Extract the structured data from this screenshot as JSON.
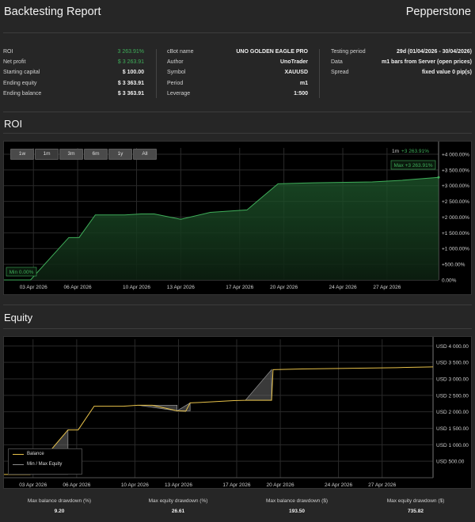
{
  "header": {
    "title": "Backtesting Report",
    "brand": "Pepperstone"
  },
  "summary": {
    "col1": [
      {
        "label": "ROI",
        "value": "3 263.91%",
        "color": "green"
      },
      {
        "label": "Net profit",
        "value": "$ 3 263.91",
        "color": "green"
      },
      {
        "label": "Starting capital",
        "value": "$ 100.00"
      },
      {
        "label": "Ending equity",
        "value": "$ 3 363.91"
      },
      {
        "label": "Ending balance",
        "value": "$ 3 363.91"
      }
    ],
    "col2": [
      {
        "label": "cBot name",
        "value": "UNO GOLDEN EAGLE PRO"
      },
      {
        "label": "Author",
        "value": "UnoTrader"
      },
      {
        "label": "Symbol",
        "value": "XAUUSD"
      },
      {
        "label": "Period",
        "value": "m1"
      },
      {
        "label": "Leverage",
        "value": "1:500"
      }
    ],
    "col3": [
      {
        "label": "Testing period",
        "value": "29d (01/04/2026 - 30/04/2026)"
      },
      {
        "label": "Data",
        "value": "m1 bars from Server (open prices)"
      },
      {
        "label": "Spread",
        "value": "fixed value 0 pip(s)"
      }
    ]
  },
  "roi_section": {
    "title": "ROI",
    "range_buttons": [
      "1w",
      "1m",
      "3m",
      "6m",
      "1y",
      "All"
    ],
    "active_range": "1m",
    "period_label": "1m",
    "current_label": "+3 263.91%",
    "max_label": "Max +3 263.91%",
    "min_label": "Min 0.00%"
  },
  "equity_section": {
    "title": "Equity",
    "legend": [
      "Balance",
      "Min / Max Equity"
    ]
  },
  "colors": {
    "roi_line": "#3fae5a",
    "balance_line": "#e8c24a",
    "equity_band": "#6a6a6a",
    "green_text": "#3fae5a"
  },
  "chart_data": [
    {
      "type": "area",
      "title": "ROI",
      "x_ticks": [
        "03 Apr 2026",
        "06 Apr 2026",
        "10 Apr 2026",
        "13 Apr 2026",
        "17 Apr 2026",
        "20 Apr 2026",
        "24 Apr 2026",
        "27 Apr 2026"
      ],
      "y_ticks": [
        "+4 000.00%",
        "+3 500.00%",
        "+3 000.00%",
        "+2 500.00%",
        "+2 000.00%",
        "+1 500.00%",
        "+1 000.00%",
        "+500.00%",
        "0.00%"
      ],
      "ylim": [
        0,
        4200
      ],
      "day_range": [
        1,
        30.5
      ],
      "series": [
        {
          "name": "ROI",
          "points": [
            [
              1,
              0
            ],
            [
              2.8,
              0
            ],
            [
              5.4,
              1350
            ],
            [
              6.1,
              1350
            ],
            [
              7.2,
              2070
            ],
            [
              9.2,
              2070
            ],
            [
              10.3,
              2100
            ],
            [
              11.2,
              2100
            ],
            [
              13.0,
              1930
            ],
            [
              15.0,
              2150
            ],
            [
              17.5,
              2230
            ],
            [
              19.6,
              3060
            ],
            [
              22.0,
              3090
            ],
            [
              26.0,
              3120
            ],
            [
              28.0,
              3170
            ],
            [
              30.5,
              3263.91
            ]
          ]
        }
      ]
    },
    {
      "type": "line",
      "title": "Equity",
      "x_ticks": [
        "03 Apr 2026",
        "06 Apr 2026",
        "10 Apr 2026",
        "13 Apr 2026",
        "17 Apr 2026",
        "20 Apr 2026",
        "24 Apr 2026",
        "27 Apr 2026"
      ],
      "y_ticks": [
        "USD 4 000.00",
        "USD 3 500.00",
        "USD 3 000.00",
        "USD 2 500.00",
        "USD 2 000.00",
        "USD 1 500.00",
        "USD 1 000.00",
        "USD 500.00"
      ],
      "ylim": [
        0,
        4200
      ],
      "day_range": [
        1,
        30.5
      ],
      "series": [
        {
          "name": "Balance",
          "points": [
            [
              1,
              100
            ],
            [
              2.8,
              100
            ],
            [
              5.4,
              1450
            ],
            [
              6.1,
              1450
            ],
            [
              7.2,
              2170
            ],
            [
              9.2,
              2170
            ],
            [
              10.2,
              2200
            ],
            [
              11.2,
              2200
            ],
            [
              12.9,
              2030
            ],
            [
              13.5,
              2020
            ],
            [
              13.8,
              2270
            ],
            [
              15.2,
              2300
            ],
            [
              16.8,
              2340
            ],
            [
              17.6,
              2350
            ],
            [
              19.4,
              2350
            ],
            [
              19.5,
              3280
            ],
            [
              21.5,
              3300
            ],
            [
              25.0,
              3320
            ],
            [
              28.0,
              3340
            ],
            [
              30.5,
              3363.91
            ]
          ]
        },
        {
          "name": "Min / Max Equity",
          "bands": [
            [
              [
                2.8,
                100
              ],
              [
                5.4,
                1450
              ],
              [
                5.4,
                100
              ]
            ],
            [
              [
                10.2,
                2200
              ],
              [
                12.9,
                2200
              ],
              [
                12.9,
                2030
              ]
            ],
            [
              [
                12.9,
                2030
              ],
              [
                13.8,
                2270
              ],
              [
                13.8,
                2030
              ]
            ],
            [
              [
                17.6,
                2350
              ],
              [
                19.4,
                3280
              ],
              [
                19.4,
                2350
              ]
            ]
          ]
        }
      ]
    }
  ],
  "stats": [
    {
      "label": "Max balance drawdown (%)",
      "value": "9.20"
    },
    {
      "label": "Max equity drawdown (%)",
      "value": "26.61"
    },
    {
      "label": "Max balance drawdown ($)",
      "value": "193.50"
    },
    {
      "label": "Max equity drawdown ($)",
      "value": "735.82"
    }
  ]
}
